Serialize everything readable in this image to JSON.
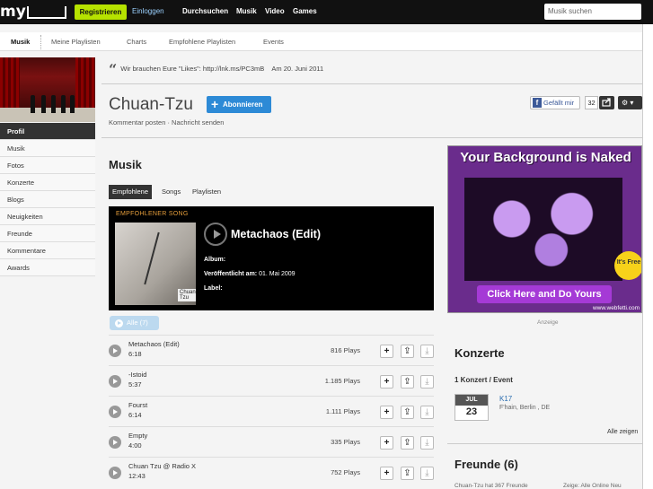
{
  "topbar": {
    "logo": "my",
    "register": "Registrieren",
    "login": "Einloggen",
    "nav": [
      "Durchsuchen",
      "Musik",
      "Video",
      "Games"
    ],
    "search_placeholder": "Musik suchen"
  },
  "subnav": [
    "Musik",
    "Meine Playlisten",
    "Charts",
    "Empfohlene Playlisten",
    "Events"
  ],
  "sidebar": [
    "Profil",
    "Musik",
    "Fotos",
    "Konzerte",
    "Blogs",
    "Neuigkeiten",
    "Freunde",
    "Kommentare",
    "Awards"
  ],
  "quote": {
    "text": "Wir brauchen Eure \"Likes\": http://lnk.ms/PC3mB",
    "date": "Am 20. Juni 2011"
  },
  "artist": {
    "name": "Chuan-Tzu",
    "subscribe": "Abonnieren",
    "links": "Kommentar posten · Nachricht senden",
    "like": "Gefällt mir",
    "like_count": "32"
  },
  "music": {
    "title": "Musik",
    "tabs": [
      "Empfohlene",
      "Songs",
      "Playlisten"
    ],
    "featured_label": "EMPFOHLENER SONG",
    "featured_title": "Metachaos (Edit)",
    "album_label": "Album:",
    "released_label": "Veröffentlicht am:",
    "released_value": "01. Mai 2009",
    "label_label": "Label:",
    "cover_tag": "Chuan Tzu",
    "all_button": "Alle (7)",
    "tracks": [
      {
        "name": "Metachaos (Edit)",
        "duration": "6:18",
        "plays": "816 Plays"
      },
      {
        "name": "-Istoid",
        "duration": "5:37",
        "plays": "1.185 Plays"
      },
      {
        "name": "Fourst",
        "duration": "6:14",
        "plays": "1.111 Plays"
      },
      {
        "name": "Empty",
        "duration": "4:00",
        "plays": "335 Plays"
      },
      {
        "name": "Chuan Tzu @ Radio X",
        "duration": "12:43",
        "plays": "752 Plays"
      }
    ]
  },
  "ad": {
    "headline": "Your Background is Naked",
    "free": "It's Free",
    "cta": "Click Here and Do Yours",
    "url": "www.webfetti.com",
    "label": "Anzeige"
  },
  "concerts": {
    "title": "Konzerte",
    "count": "1 Konzert / Event",
    "month": "JUL",
    "day": "23",
    "event": "K17",
    "location": "F'hain, Berlin , DE",
    "all": "Alle zeigen"
  },
  "friends": {
    "title": "Freunde (6)",
    "line": "Chuan-Tzu hat 367 Freunde",
    "filter": "Zeige: Alle  Online  Neu"
  }
}
